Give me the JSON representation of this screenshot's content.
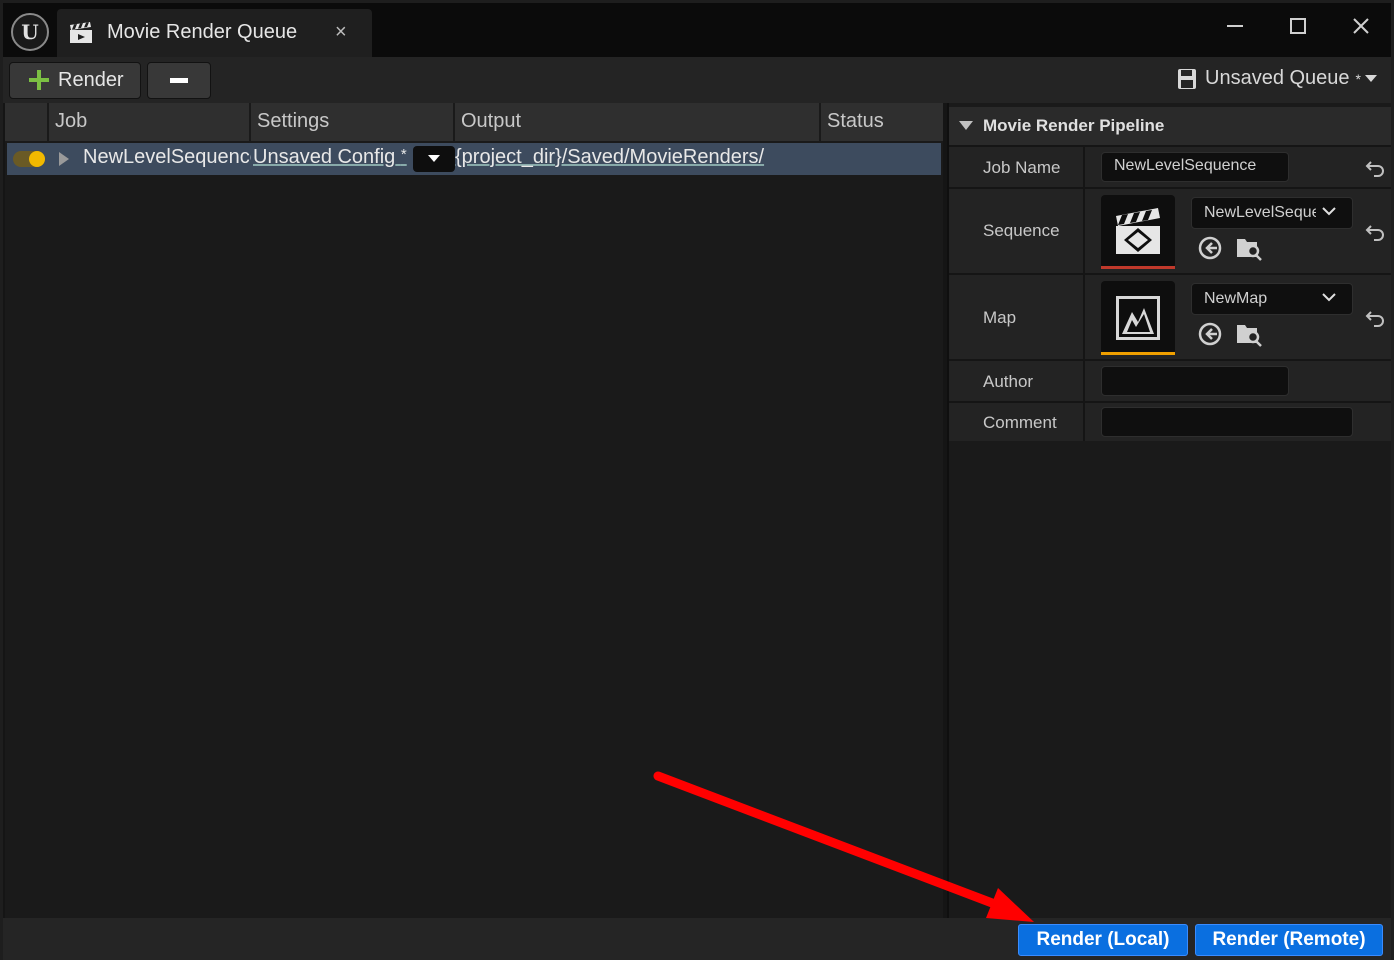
{
  "window": {
    "logo_text": "U",
    "tab_title": "Movie Render Queue",
    "tab_close": "×"
  },
  "toolbar": {
    "render_label": "Render",
    "queue_label": "Unsaved Queue",
    "queue_dirty": "*"
  },
  "queue": {
    "columns": [
      "Job",
      "Settings",
      "Output",
      "Status"
    ],
    "jobs": [
      {
        "name": "NewLevelSequence",
        "settings": "Unsaved Config",
        "settings_dirty": "*",
        "output": "{project_dir}/Saved/MovieRenders/",
        "enabled": true
      }
    ]
  },
  "details": {
    "section_title": "Movie Render Pipeline",
    "job_name_label": "Job Name",
    "job_name_value": "NewLevelSequence",
    "sequence_label": "Sequence",
    "sequence_value": "NewLevelSeque",
    "map_label": "Map",
    "map_value": "NewMap",
    "author_label": "Author",
    "author_value": "",
    "comment_label": "Comment",
    "comment_value": ""
  },
  "footer": {
    "render_local": "Render (Local)",
    "render_remote": "Render (Remote)"
  },
  "colors": {
    "accent_blue": "#0a6fe0",
    "selected_row": "#3d4b5e",
    "toggle_on": "#f2b900",
    "sequence_accent": "#c0392b",
    "map_accent": "#f0a000",
    "annotation_arrow": "#ff0000"
  }
}
